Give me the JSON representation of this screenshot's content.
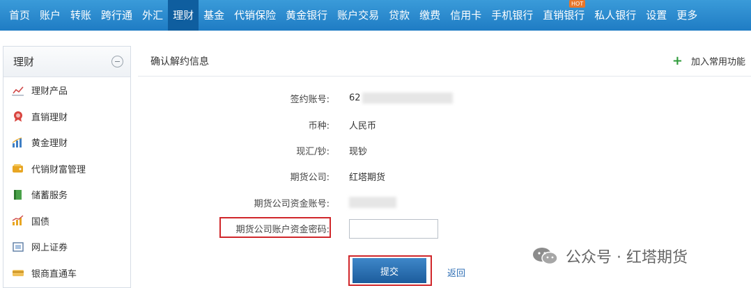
{
  "topnav": {
    "items": [
      {
        "label": "首页"
      },
      {
        "label": "账户"
      },
      {
        "label": "转账"
      },
      {
        "label": "跨行通"
      },
      {
        "label": "外汇"
      },
      {
        "label": "理财"
      },
      {
        "label": "基金"
      },
      {
        "label": "代销保险"
      },
      {
        "label": "黄金银行"
      },
      {
        "label": "账户交易"
      },
      {
        "label": "贷款"
      },
      {
        "label": "缴费"
      },
      {
        "label": "信用卡"
      },
      {
        "label": "手机银行"
      },
      {
        "label": "直销银行"
      },
      {
        "label": "私人银行"
      },
      {
        "label": "设置"
      },
      {
        "label": "更多"
      }
    ],
    "active_index": 5,
    "hot_badge": "HOT"
  },
  "sidebar": {
    "title": "理财",
    "items": [
      {
        "label": "理财产品",
        "icon": "chart-line-icon"
      },
      {
        "label": "直销理财",
        "icon": "badge-icon"
      },
      {
        "label": "黄金理财",
        "icon": "bar-chart-icon"
      },
      {
        "label": "代销财富管理",
        "icon": "wallet-icon"
      },
      {
        "label": "储蓄服务",
        "icon": "book-icon"
      },
      {
        "label": "国债",
        "icon": "growth-chart-icon"
      },
      {
        "label": "网上证券",
        "icon": "monitor-icon"
      },
      {
        "label": "银商直通车",
        "icon": "card-icon"
      }
    ]
  },
  "main": {
    "title": "确认解约信息",
    "add_favorite": "加入常用功能",
    "fields": {
      "account_label": "签约账号:",
      "account_value": "62",
      "currency_label": "币种:",
      "currency_value": "人民币",
      "cash_label": "现汇/钞:",
      "cash_value": "现钞",
      "company_label": "期货公司:",
      "company_value": "红塔期货",
      "fund_account_label": "期货公司资金账号:",
      "password_label": "期货公司账户资金密码:"
    },
    "submit_label": "提交",
    "back_label": "返回"
  },
  "watermark": {
    "text": "公众号 · 红塔期货"
  },
  "colors": {
    "nav_bg": "#2b8ad0",
    "nav_active": "#0f5e9f",
    "highlight_box": "#d0262a",
    "submit_bg": "#2a6fb2"
  }
}
